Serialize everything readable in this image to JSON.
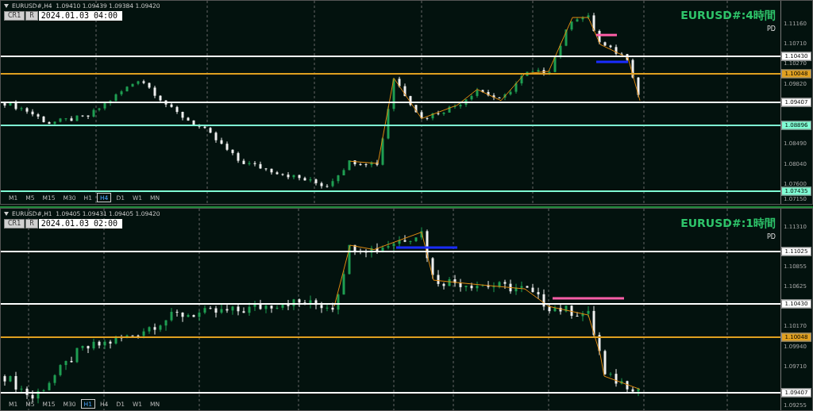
{
  "charts": [
    {
      "header": "EURUSD#,H4  1.09410 1.09439 1.09384 1.09420",
      "buttons": [
        "CR1",
        "R"
      ],
      "date": "2024.01.03 04:00",
      "title": "EURUSD#:4時間",
      "subtitle": "PD",
      "axis_labels": [
        "1.11160",
        "1.10710",
        "1.10270",
        "1.09820",
        "1.08490",
        "1.08040",
        "1.07600",
        "1.07150"
      ],
      "levels": [
        {
          "price": "1.10430",
          "color": "#ffffff"
        },
        {
          "price": "1.10048",
          "color": "#e0a020"
        },
        {
          "price": "1.09407",
          "color": "#ffffff"
        },
        {
          "price": "1.08896",
          "color": "#7fffd4"
        },
        {
          "price": "1.07435",
          "color": "#7fffd4"
        }
      ],
      "timeframes": [
        {
          "label": "M1",
          "selected": false
        },
        {
          "label": "M5",
          "selected": false
        },
        {
          "label": "M15",
          "selected": false
        },
        {
          "label": "M30",
          "selected": false
        },
        {
          "label": "H1",
          "selected": false
        },
        {
          "label": "H4",
          "selected": true
        },
        {
          "label": "D1",
          "selected": false
        },
        {
          "label": "W1",
          "selected": false
        },
        {
          "label": "MN",
          "selected": false
        }
      ]
    },
    {
      "header": "EURUSD#,H1  1.09405 1.09431 1.09405 1.09420",
      "buttons": [
        "CR1",
        "R"
      ],
      "date": "2024.01.03 02:00",
      "title": "EURUSD#:1時間",
      "subtitle": "PD",
      "axis_labels": [
        "1.11310",
        "1.10855",
        "1.10625",
        "1.10170",
        "1.09940",
        "1.09710",
        "1.09255"
      ],
      "levels": [
        {
          "price": "1.11025",
          "color": "#ffffff"
        },
        {
          "price": "1.10430",
          "color": "#ffffff"
        },
        {
          "price": "1.10048",
          "color": "#e0a020"
        },
        {
          "price": "1.09407",
          "color": "#ffffff"
        }
      ],
      "timeframes": [
        {
          "label": "M1",
          "selected": false
        },
        {
          "label": "M5",
          "selected": false
        },
        {
          "label": "M15",
          "selected": false
        },
        {
          "label": "M30",
          "selected": false
        },
        {
          "label": "H1",
          "selected": true
        },
        {
          "label": "H4",
          "selected": false
        },
        {
          "label": "D1",
          "selected": false
        },
        {
          "label": "W1",
          "selected": false
        },
        {
          "label": "MN",
          "selected": false
        }
      ]
    }
  ]
}
